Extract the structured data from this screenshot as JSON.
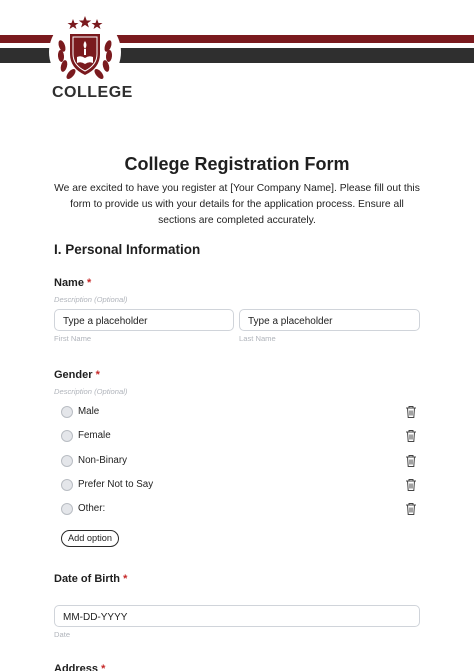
{
  "header": {
    "logo_text": "COLLEGE",
    "colors": {
      "accent_red": "#7a1a1e",
      "dark_band": "#2f2f2f"
    }
  },
  "form": {
    "title": "College Registration Form",
    "intro": "We are excited to have you register at [Your Company Name]. Please fill out this form to provide us with your details for the application process. Ensure all sections are completed accurately."
  },
  "section1": {
    "title": "I. Personal Information"
  },
  "name_field": {
    "label": "Name",
    "required_mark": "*",
    "description": "Description (Optional)",
    "first": {
      "placeholder": "Type a placeholder",
      "sublabel": "First Name"
    },
    "last": {
      "placeholder": "Type a placeholder",
      "sublabel": "Last Name"
    }
  },
  "gender_field": {
    "label": "Gender",
    "required_mark": "*",
    "description": "Description (Optional)",
    "options": [
      {
        "label": "Male",
        "icon": "trash-icon"
      },
      {
        "label": "Female",
        "icon": "trash-icon"
      },
      {
        "label": "Non-Binary",
        "icon": "trash-icon"
      },
      {
        "label": "Prefer Not to Say",
        "icon": "trash-icon"
      },
      {
        "label": "Other:",
        "icon": "trash-icon"
      }
    ],
    "add_option_label": "Add option"
  },
  "dob_field": {
    "label": "Date of Birth",
    "required_mark": "*",
    "placeholder": "MM-DD-YYYY",
    "sublabel": "Date"
  },
  "address_field": {
    "label": "Address",
    "required_mark": "*"
  }
}
